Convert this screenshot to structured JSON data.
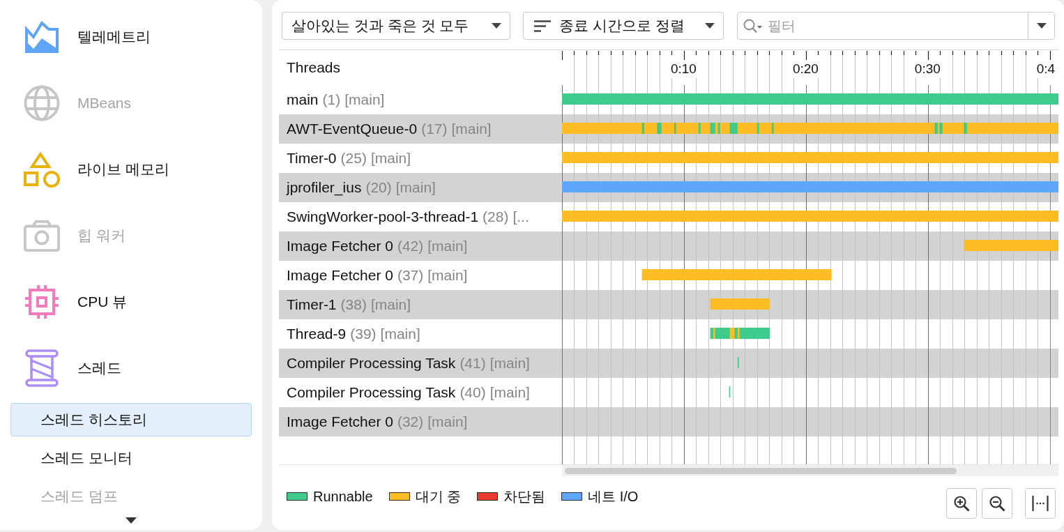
{
  "sidebar": {
    "items": [
      {
        "label": "텔레메트리",
        "selected": false,
        "disabled": false
      },
      {
        "label": "MBeans",
        "selected": false,
        "disabled": true
      },
      {
        "label": "라이브 메모리",
        "selected": false,
        "disabled": false
      },
      {
        "label": "힙 워커",
        "selected": false,
        "disabled": true
      },
      {
        "label": "CPU 뷰",
        "selected": false,
        "disabled": false
      },
      {
        "label": "스레드",
        "selected": false,
        "disabled": false,
        "children": [
          {
            "label": "스레드 히스토리",
            "selected": true,
            "disabled": false
          },
          {
            "label": "스레드 모니터",
            "selected": false,
            "disabled": false
          },
          {
            "label": "스레드 덤프",
            "selected": false,
            "disabled": true
          }
        ]
      }
    ]
  },
  "toolbar": {
    "mode_dropdown": {
      "value": "살아있는 것과 죽은 것 모두"
    },
    "sort_dropdown": {
      "value": "종료 시간으로 정렬"
    },
    "filter": {
      "placeholder": "필터"
    }
  },
  "threads": {
    "header": "Threads",
    "rows": [
      {
        "name": "main",
        "id": "(1)",
        "group": "[main]"
      },
      {
        "name": "AWT-EventQueue-0",
        "id": "(17)",
        "group": "[main]"
      },
      {
        "name": "Timer-0",
        "id": "(25)",
        "group": "[main]"
      },
      {
        "name": "jprofiler_ius",
        "id": "(20)",
        "group": "[main]"
      },
      {
        "name": "SwingWorker-pool-3-thread-1",
        "id": "(28)",
        "group": "[..."
      },
      {
        "name": "Image Fetcher 0",
        "id": "(42)",
        "group": "[main]"
      },
      {
        "name": "Image Fetcher 0",
        "id": "(37)",
        "group": "[main]"
      },
      {
        "name": "Timer-1",
        "id": "(38)",
        "group": "[main]"
      },
      {
        "name": "Thread-9",
        "id": "(39)",
        "group": "[main]"
      },
      {
        "name": "Compiler Processing Task",
        "id": "(41)",
        "group": "[main]"
      },
      {
        "name": "Compiler Processing Task",
        "id": "(40)",
        "group": "[main]"
      },
      {
        "name": "Image Fetcher 0",
        "id": "(32)",
        "group": "[main]"
      }
    ]
  },
  "timeline": {
    "ticks": [
      "0:10",
      "0:20",
      "0:30",
      "0:4"
    ]
  },
  "legend": [
    {
      "label": "Runnable",
      "color": "#3fcb8b"
    },
    {
      "label": "대기 중",
      "color": "#fbbd23"
    },
    {
      "label": "차단됨",
      "color": "#e8392e"
    },
    {
      "label": "네트 I/O",
      "color": "#5ea6f9"
    }
  ]
}
